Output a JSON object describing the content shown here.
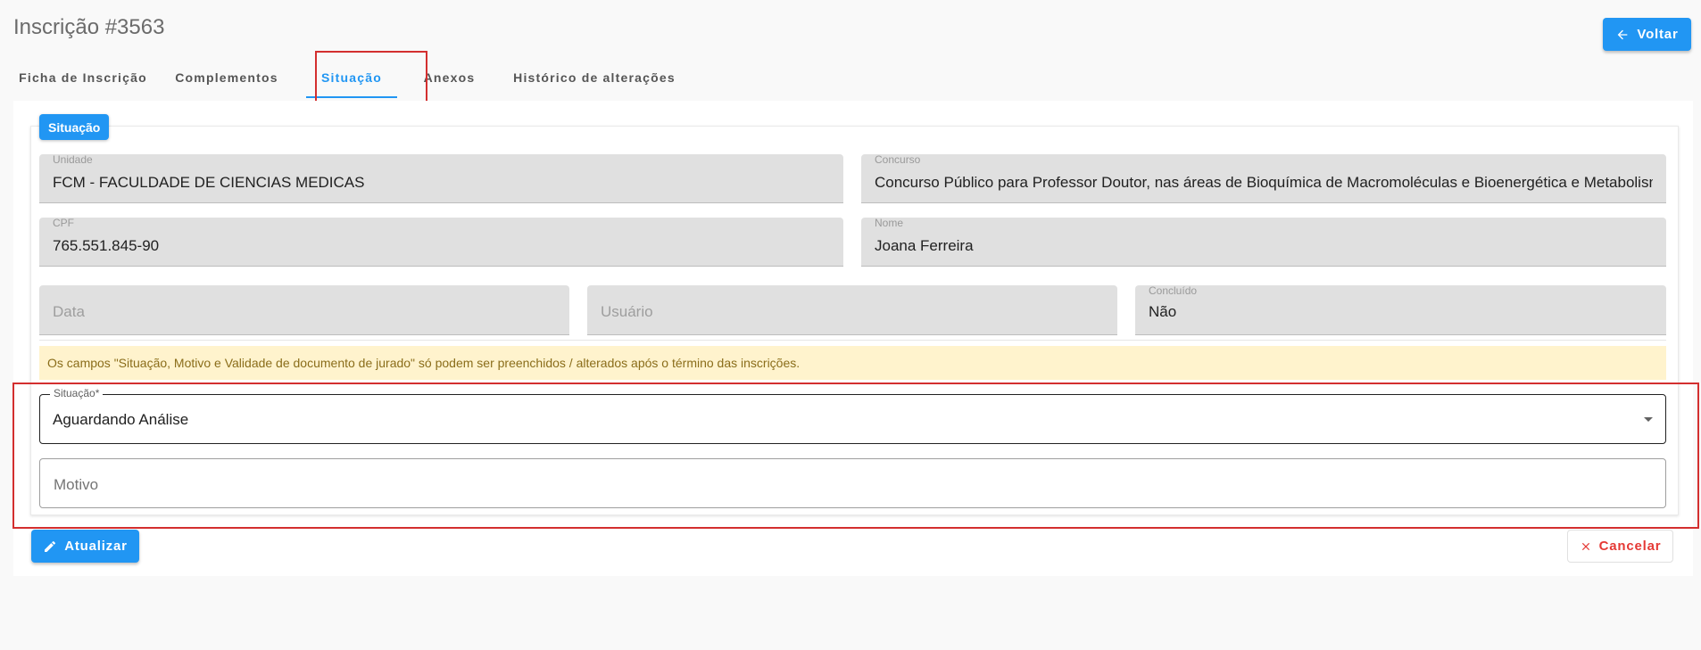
{
  "header": {
    "title": "Inscrição #3563",
    "back_label": "Voltar"
  },
  "tabs": [
    {
      "label": "Ficha de Inscrição",
      "active": false
    },
    {
      "label": "Complementos",
      "active": false
    },
    {
      "label": "Situação",
      "active": true
    },
    {
      "label": "Anexos",
      "active": false
    },
    {
      "label": "Histórico de alterações",
      "active": false
    }
  ],
  "section": {
    "chip_label": "Situação"
  },
  "fields": {
    "unidade": {
      "label": "Unidade",
      "value": "FCM - FACULDADE DE CIENCIAS MEDICAS"
    },
    "concurso": {
      "label": "Concurso",
      "value": "Concurso Público para Professor Doutor, nas áreas de Bioquímica de Macromoléculas e Bioenergética e Metabolismo"
    },
    "cpf": {
      "label": "CPF",
      "value": "765.551.845-90"
    },
    "nome": {
      "label": "Nome",
      "value": "Joana Ferreira"
    },
    "data": {
      "placeholder": "Data"
    },
    "usuario": {
      "placeholder": "Usuário"
    },
    "concluido": {
      "label": "Concluído",
      "value": "Não"
    }
  },
  "alert": {
    "text": "Os campos \"Situação, Motivo e Validade de documento de jurado\" só podem ser preenchidos / alterados após o término das inscrições."
  },
  "situacao_select": {
    "label": "Situação*",
    "value": "Aguardando Análise"
  },
  "motivo": {
    "placeholder": "Motivo"
  },
  "actions": {
    "update_label": "Atualizar",
    "cancel_label": "Cancelar"
  },
  "colors": {
    "primary": "#2196f3",
    "danger": "#e53935",
    "highlight": "#d32f2f",
    "alert_bg": "#fff3cd"
  },
  "icons": {
    "back": "arrow-left-icon",
    "update": "pencil-icon",
    "cancel": "close-icon",
    "select": "caret-down-icon"
  }
}
